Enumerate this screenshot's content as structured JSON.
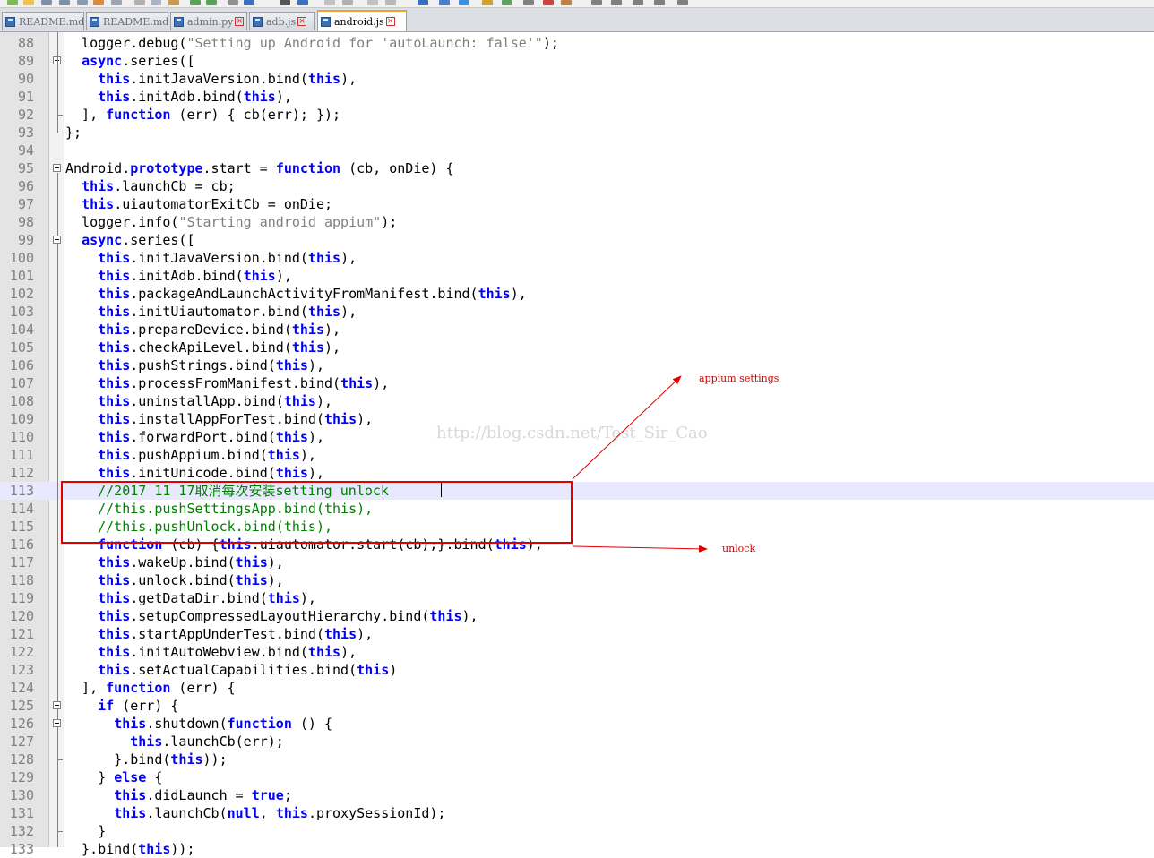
{
  "tabs": [
    {
      "label": "README.md",
      "active": false
    },
    {
      "label": "README.md",
      "active": false
    },
    {
      "label": "admin.py",
      "active": false
    },
    {
      "label": "adb.js",
      "active": false
    },
    {
      "label": "android.js",
      "active": true
    }
  ],
  "current_line": 113,
  "watermark": "http://blog.csdn.net/Test_Sir_Cao",
  "annotations": {
    "appium_settings": "appium settings",
    "unlock": "unlock"
  },
  "colors": {
    "keyword": "#0000ff",
    "string": "#808080",
    "comment": "#008000",
    "annotation": "#cc0000",
    "current_line_bg": "#e8e8ff"
  },
  "lines": [
    {
      "n": 88,
      "code": [
        [
          "",
          "  logger.debug("
        ],
        [
          "str",
          "\"Setting up Android for 'autoLaunch: false'\""
        ],
        [
          "",
          ");"
        ]
      ]
    },
    {
      "n": 89,
      "code": [
        [
          "",
          "  "
        ],
        [
          "kw",
          "async"
        ],
        [
          "",
          ".series(["
        ]
      ]
    },
    {
      "n": 90,
      "code": [
        [
          "",
          "    "
        ],
        [
          "kw",
          "this"
        ],
        [
          "",
          ".initJavaVersion.bind("
        ],
        [
          "kw",
          "this"
        ],
        [
          "",
          "),"
        ]
      ]
    },
    {
      "n": 91,
      "code": [
        [
          "",
          "    "
        ],
        [
          "kw",
          "this"
        ],
        [
          "",
          ".initAdb.bind("
        ],
        [
          "kw",
          "this"
        ],
        [
          "",
          "),"
        ]
      ]
    },
    {
      "n": 92,
      "code": [
        [
          "",
          "  ], "
        ],
        [
          "kw",
          "function"
        ],
        [
          "",
          " (err) { cb(err); });"
        ]
      ]
    },
    {
      "n": 93,
      "code": [
        [
          "",
          "};"
        ]
      ]
    },
    {
      "n": 94,
      "code": [
        [
          "",
          ""
        ]
      ]
    },
    {
      "n": 95,
      "code": [
        [
          "",
          "Android."
        ],
        [
          "kw",
          "prototype"
        ],
        [
          "",
          ".start = "
        ],
        [
          "kw",
          "function"
        ],
        [
          "",
          " (cb, onDie) {"
        ]
      ]
    },
    {
      "n": 96,
      "code": [
        [
          "",
          "  "
        ],
        [
          "kw",
          "this"
        ],
        [
          "",
          ".launchCb = cb;"
        ]
      ]
    },
    {
      "n": 97,
      "code": [
        [
          "",
          "  "
        ],
        [
          "kw",
          "this"
        ],
        [
          "",
          ".uiautomatorExitCb = onDie;"
        ]
      ]
    },
    {
      "n": 98,
      "code": [
        [
          "",
          "  logger.info("
        ],
        [
          "str",
          "\"Starting android appium\""
        ],
        [
          "",
          ");"
        ]
      ]
    },
    {
      "n": 99,
      "code": [
        [
          "",
          "  "
        ],
        [
          "kw",
          "async"
        ],
        [
          "",
          ".series(["
        ]
      ]
    },
    {
      "n": 100,
      "code": [
        [
          "",
          "    "
        ],
        [
          "kw",
          "this"
        ],
        [
          "",
          ".initJavaVersion.bind("
        ],
        [
          "kw",
          "this"
        ],
        [
          "",
          "),"
        ]
      ]
    },
    {
      "n": 101,
      "code": [
        [
          "",
          "    "
        ],
        [
          "kw",
          "this"
        ],
        [
          "",
          ".initAdb.bind("
        ],
        [
          "kw",
          "this"
        ],
        [
          "",
          "),"
        ]
      ]
    },
    {
      "n": 102,
      "code": [
        [
          "",
          "    "
        ],
        [
          "kw",
          "this"
        ],
        [
          "",
          ".packageAndLaunchActivityFromManifest.bind("
        ],
        [
          "kw",
          "this"
        ],
        [
          "",
          "),"
        ]
      ]
    },
    {
      "n": 103,
      "code": [
        [
          "",
          "    "
        ],
        [
          "kw",
          "this"
        ],
        [
          "",
          ".initUiautomator.bind("
        ],
        [
          "kw",
          "this"
        ],
        [
          "",
          "),"
        ]
      ]
    },
    {
      "n": 104,
      "code": [
        [
          "",
          "    "
        ],
        [
          "kw",
          "this"
        ],
        [
          "",
          ".prepareDevice.bind("
        ],
        [
          "kw",
          "this"
        ],
        [
          "",
          "),"
        ]
      ]
    },
    {
      "n": 105,
      "code": [
        [
          "",
          "    "
        ],
        [
          "kw",
          "this"
        ],
        [
          "",
          ".checkApiLevel.bind("
        ],
        [
          "kw",
          "this"
        ],
        [
          "",
          "),"
        ]
      ]
    },
    {
      "n": 106,
      "code": [
        [
          "",
          "    "
        ],
        [
          "kw",
          "this"
        ],
        [
          "",
          ".pushStrings.bind("
        ],
        [
          "kw",
          "this"
        ],
        [
          "",
          "),"
        ]
      ]
    },
    {
      "n": 107,
      "code": [
        [
          "",
          "    "
        ],
        [
          "kw",
          "this"
        ],
        [
          "",
          ".processFromManifest.bind("
        ],
        [
          "kw",
          "this"
        ],
        [
          "",
          "),"
        ]
      ]
    },
    {
      "n": 108,
      "code": [
        [
          "",
          "    "
        ],
        [
          "kw",
          "this"
        ],
        [
          "",
          ".uninstallApp.bind("
        ],
        [
          "kw",
          "this"
        ],
        [
          "",
          "),"
        ]
      ]
    },
    {
      "n": 109,
      "code": [
        [
          "",
          "    "
        ],
        [
          "kw",
          "this"
        ],
        [
          "",
          ".installAppForTest.bind("
        ],
        [
          "kw",
          "this"
        ],
        [
          "",
          "),"
        ]
      ]
    },
    {
      "n": 110,
      "code": [
        [
          "",
          "    "
        ],
        [
          "kw",
          "this"
        ],
        [
          "",
          ".forwardPort.bind("
        ],
        [
          "kw",
          "this"
        ],
        [
          "",
          "),"
        ]
      ]
    },
    {
      "n": 111,
      "code": [
        [
          "",
          "    "
        ],
        [
          "kw",
          "this"
        ],
        [
          "",
          ".pushAppium.bind("
        ],
        [
          "kw",
          "this"
        ],
        [
          "",
          "),"
        ]
      ]
    },
    {
      "n": 112,
      "code": [
        [
          "",
          "    "
        ],
        [
          "kw",
          "this"
        ],
        [
          "",
          ".initUnicode.bind("
        ],
        [
          "kw",
          "this"
        ],
        [
          "",
          "),"
        ]
      ]
    },
    {
      "n": 113,
      "code": [
        [
          "",
          "    "
        ],
        [
          "cm",
          "//2017 11 17取消每次安装setting unlock"
        ]
      ]
    },
    {
      "n": 114,
      "code": [
        [
          "",
          "    "
        ],
        [
          "cm",
          "//this.pushSettingsApp.bind(this),"
        ]
      ]
    },
    {
      "n": 115,
      "code": [
        [
          "",
          "    "
        ],
        [
          "cm",
          "//this.pushUnlock.bind(this),"
        ]
      ]
    },
    {
      "n": 116,
      "code": [
        [
          "",
          "    "
        ],
        [
          "kw",
          "function"
        ],
        [
          "",
          " (cb) {"
        ],
        [
          "kw",
          "this"
        ],
        [
          "",
          ".uiautomator.start(cb);}.bind("
        ],
        [
          "kw",
          "this"
        ],
        [
          "",
          "),"
        ]
      ]
    },
    {
      "n": 117,
      "code": [
        [
          "",
          "    "
        ],
        [
          "kw",
          "this"
        ],
        [
          "",
          ".wakeUp.bind("
        ],
        [
          "kw",
          "this"
        ],
        [
          "",
          "),"
        ]
      ]
    },
    {
      "n": 118,
      "code": [
        [
          "",
          "    "
        ],
        [
          "kw",
          "this"
        ],
        [
          "",
          ".unlock.bind("
        ],
        [
          "kw",
          "this"
        ],
        [
          "",
          "),"
        ]
      ]
    },
    {
      "n": 119,
      "code": [
        [
          "",
          "    "
        ],
        [
          "kw",
          "this"
        ],
        [
          "",
          ".getDataDir.bind("
        ],
        [
          "kw",
          "this"
        ],
        [
          "",
          "),"
        ]
      ]
    },
    {
      "n": 120,
      "code": [
        [
          "",
          "    "
        ],
        [
          "kw",
          "this"
        ],
        [
          "",
          ".setupCompressedLayoutHierarchy.bind("
        ],
        [
          "kw",
          "this"
        ],
        [
          "",
          "),"
        ]
      ]
    },
    {
      "n": 121,
      "code": [
        [
          "",
          "    "
        ],
        [
          "kw",
          "this"
        ],
        [
          "",
          ".startAppUnderTest.bind("
        ],
        [
          "kw",
          "this"
        ],
        [
          "",
          "),"
        ]
      ]
    },
    {
      "n": 122,
      "code": [
        [
          "",
          "    "
        ],
        [
          "kw",
          "this"
        ],
        [
          "",
          ".initAutoWebview.bind("
        ],
        [
          "kw",
          "this"
        ],
        [
          "",
          "),"
        ]
      ]
    },
    {
      "n": 123,
      "code": [
        [
          "",
          "    "
        ],
        [
          "kw",
          "this"
        ],
        [
          "",
          ".setActualCapabilities.bind("
        ],
        [
          "kw",
          "this"
        ],
        [
          "",
          ")"
        ]
      ]
    },
    {
      "n": 124,
      "code": [
        [
          "",
          "  ], "
        ],
        [
          "kw",
          "function"
        ],
        [
          "",
          " (err) {"
        ]
      ]
    },
    {
      "n": 125,
      "code": [
        [
          "",
          "    "
        ],
        [
          "kw",
          "if"
        ],
        [
          "",
          " (err) {"
        ]
      ]
    },
    {
      "n": 126,
      "code": [
        [
          "",
          "      "
        ],
        [
          "kw",
          "this"
        ],
        [
          "",
          ".shutdown("
        ],
        [
          "kw",
          "function"
        ],
        [
          "",
          " () {"
        ]
      ]
    },
    {
      "n": 127,
      "code": [
        [
          "",
          "        "
        ],
        [
          "kw",
          "this"
        ],
        [
          "",
          ".launchCb(err);"
        ]
      ]
    },
    {
      "n": 128,
      "code": [
        [
          "",
          "      }.bind("
        ],
        [
          "kw",
          "this"
        ],
        [
          "",
          "));"
        ]
      ]
    },
    {
      "n": 129,
      "code": [
        [
          "",
          "    } "
        ],
        [
          "kw",
          "else"
        ],
        [
          "",
          " {"
        ]
      ]
    },
    {
      "n": 130,
      "code": [
        [
          "",
          "      "
        ],
        [
          "kw",
          "this"
        ],
        [
          "",
          ".didLaunch = "
        ],
        [
          "kw",
          "true"
        ],
        [
          "",
          ";"
        ]
      ]
    },
    {
      "n": 131,
      "code": [
        [
          "",
          "      "
        ],
        [
          "kw",
          "this"
        ],
        [
          "",
          ".launchCb("
        ],
        [
          "kw",
          "null"
        ],
        [
          "",
          ", "
        ],
        [
          "kw",
          "this"
        ],
        [
          "",
          ".proxySessionId);"
        ]
      ]
    },
    {
      "n": 132,
      "code": [
        [
          "",
          "    }"
        ]
      ]
    },
    {
      "n": 133,
      "code": [
        [
          "",
          "  }.bind("
        ],
        [
          "kw",
          "this"
        ],
        [
          "",
          "));"
        ]
      ]
    }
  ]
}
